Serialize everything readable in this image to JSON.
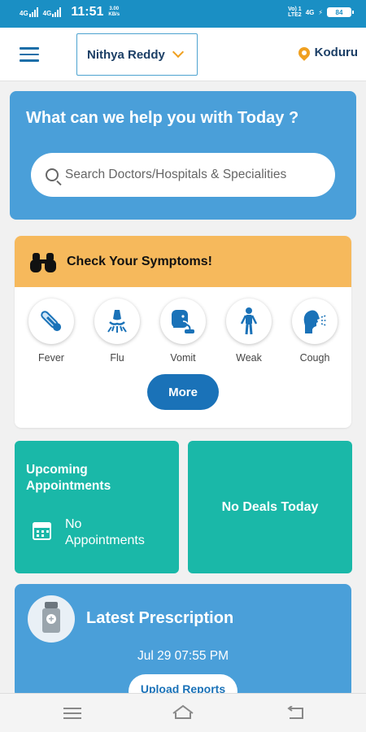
{
  "status_bar": {
    "signal1": "4G",
    "signal2": "4G",
    "time": "11:51",
    "speed_value": "3.00",
    "speed_unit": "KB/s",
    "volte_top": "Vo) 1",
    "volte_bottom": "LTE2",
    "net": "4G",
    "battery": "84"
  },
  "header": {
    "user_name": "Nithya Reddy",
    "location": "Koduru"
  },
  "search": {
    "heading": "What can we help you with Today ?",
    "placeholder": "Search Doctors/Hospitals & Specialities"
  },
  "symptoms": {
    "title": "Check Your Symptoms!",
    "items": [
      {
        "label": "Fever",
        "icon": "thermometer-icon"
      },
      {
        "label": "Flu",
        "icon": "flu-icon"
      },
      {
        "label": "Vomit",
        "icon": "vomit-icon"
      },
      {
        "label": "Weak",
        "icon": "weak-person-icon"
      },
      {
        "label": "Cough",
        "icon": "cough-icon"
      }
    ],
    "more_label": "More"
  },
  "appointments": {
    "title_line1": "Upcoming",
    "title_line2": "Appointments",
    "text_line1": "No",
    "text_line2": "Appointments"
  },
  "deals": {
    "text": "No Deals Today"
  },
  "prescription": {
    "title": "Latest Prescription",
    "date": "Jul 29 07:55 PM",
    "upload_label": "Upload Reports"
  },
  "colors": {
    "status_blue": "#1a8fc4",
    "card_blue": "#4a9fd9",
    "symptom_header": "#f6b95c",
    "teal": "#1ab8a8",
    "button_blue": "#1a72b8",
    "accent_orange": "#f0a020"
  }
}
